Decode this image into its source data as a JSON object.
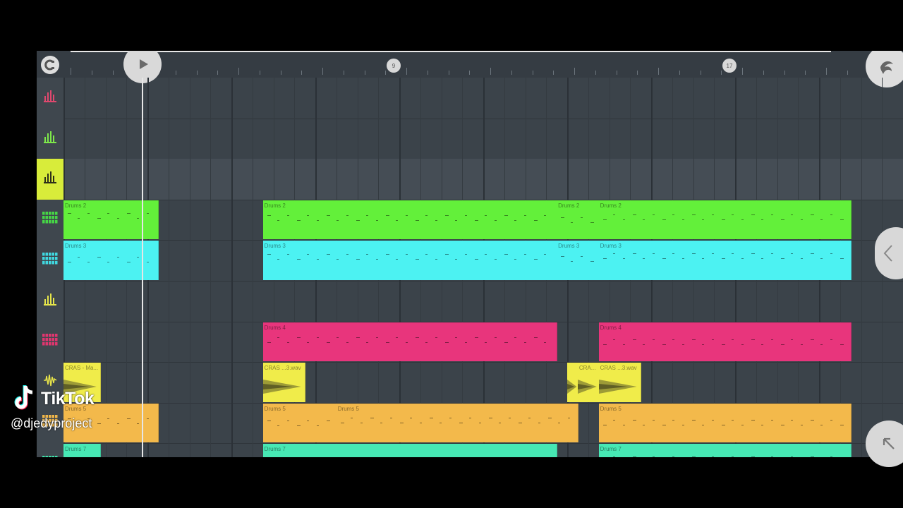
{
  "ruler": {
    "markers": [
      "9",
      "17"
    ]
  },
  "tracks": [
    {
      "icon": "bars-icon",
      "color": "#e0486e"
    },
    {
      "icon": "bars-icon",
      "color": "#7ee84a"
    },
    {
      "icon": "bars-icon",
      "color": "#3c3f1c"
    },
    {
      "icon": "grid-icon",
      "color": "#46d646"
    },
    {
      "icon": "grid-icon",
      "color": "#40d8e0"
    },
    {
      "icon": "bars-icon",
      "color": "#e6e64a"
    },
    {
      "icon": "grid-icon",
      "color": "#e0366f"
    },
    {
      "icon": "wave-icon",
      "color": "#e8e44a"
    },
    {
      "icon": "grid-icon",
      "color": "#efb64a"
    },
    {
      "icon": "grid-icon",
      "color": "#3ee0a8"
    }
  ],
  "clips": [
    {
      "label": "Drums 2",
      "color": "#63f03a",
      "row": 3,
      "start": 0,
      "end": 4.5,
      "kind": "notes"
    },
    {
      "label": "Drums 2",
      "color": "#63f03a",
      "row": 3,
      "start": 9.5,
      "end": 23.5,
      "kind": "notes"
    },
    {
      "label": "Drums 2",
      "color": "#63f03a",
      "row": 3,
      "start": 23.5,
      "end": 25.5,
      "kind": "notes"
    },
    {
      "label": "Drums 2",
      "color": "#63f03a",
      "row": 3,
      "start": 25.5,
      "end": 37.5,
      "kind": "notes"
    },
    {
      "label": "Drums 3",
      "color": "#4cf2f2",
      "row": 4,
      "start": 0,
      "end": 4.5,
      "kind": "notes"
    },
    {
      "label": "Drums 3",
      "color": "#4cf2f2",
      "row": 4,
      "start": 9.5,
      "end": 23.5,
      "kind": "notes"
    },
    {
      "label": "Drums 3",
      "color": "#4cf2f2",
      "row": 4,
      "start": 23.5,
      "end": 25.5,
      "kind": "notes"
    },
    {
      "label": "Drums 3",
      "color": "#4cf2f2",
      "row": 4,
      "start": 25.5,
      "end": 37.5,
      "kind": "notes"
    },
    {
      "label": "Drums 4",
      "color": "#e8357c",
      "row": 6,
      "start": 9.5,
      "end": 23.5,
      "kind": "notes"
    },
    {
      "label": "Drums 4",
      "color": "#e8357c",
      "row": 6,
      "start": 25.5,
      "end": 37.5,
      "kind": "notes"
    },
    {
      "label": "CRAS - Ma...",
      "color": "#f0ec4a",
      "row": 7,
      "start": 0,
      "end": 1.75,
      "kind": "wave"
    },
    {
      "label": "CRAS ...3.wav",
      "color": "#f0ec4a",
      "row": 7,
      "start": 9.5,
      "end": 11.5,
      "kind": "wave"
    },
    {
      "label": "",
      "color": "#f0ec4a",
      "row": 7,
      "start": 24.0,
      "end": 24.5,
      "kind": "wave"
    },
    {
      "label": "CRA...",
      "color": "#f0ec4a",
      "row": 7,
      "start": 24.5,
      "end": 25.5,
      "kind": "wave"
    },
    {
      "label": "CRAS ...3.wav",
      "color": "#f0ec4a",
      "row": 7,
      "start": 25.5,
      "end": 27.5,
      "kind": "wave"
    },
    {
      "label": "Drums 5",
      "color": "#f3b94b",
      "row": 8,
      "start": 0,
      "end": 4.5,
      "kind": "notes"
    },
    {
      "label": "Drums 5",
      "color": "#f3b94b",
      "row": 8,
      "start": 9.5,
      "end": 13.0,
      "kind": "notes"
    },
    {
      "label": "Drums 5",
      "color": "#f3b94b",
      "row": 8,
      "start": 13.0,
      "end": 24.5,
      "kind": "notes"
    },
    {
      "label": "Drums 5",
      "color": "#f3b94b",
      "row": 8,
      "start": 25.5,
      "end": 37.5,
      "kind": "notes"
    },
    {
      "label": "Drums 7",
      "color": "#47e8b4",
      "row": 9,
      "start": 0,
      "end": 1.75,
      "kind": "notes"
    },
    {
      "label": "Drums 7",
      "color": "#47e8b4",
      "row": 9,
      "start": 9.5,
      "end": 23.5,
      "kind": "notes"
    },
    {
      "label": "Drums 7",
      "color": "#47e8b4",
      "row": 9,
      "start": 25.5,
      "end": 37.5,
      "kind": "notes"
    }
  ],
  "watermark": {
    "brand": "TikTok",
    "handle": "@djedyproject"
  }
}
